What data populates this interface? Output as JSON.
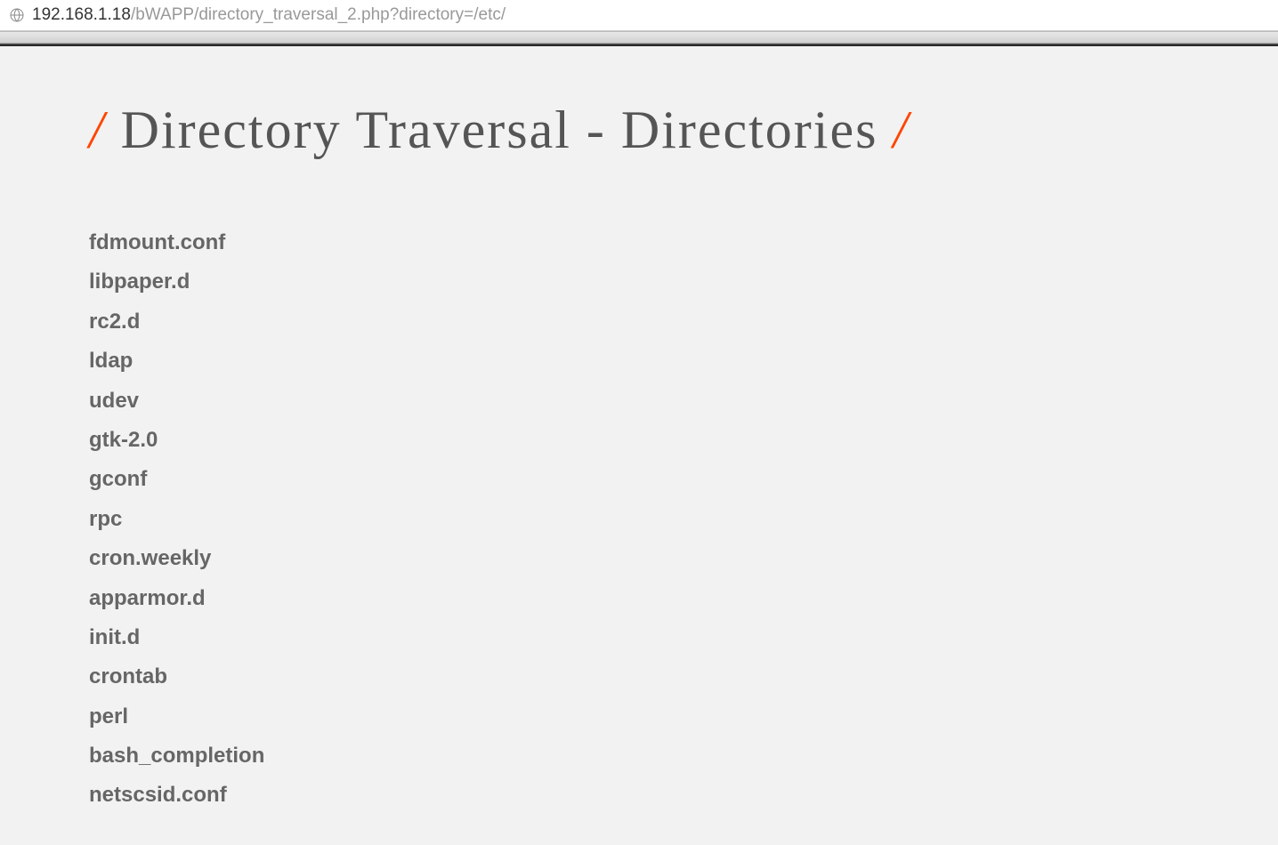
{
  "address": {
    "host": "192.168.1.18",
    "path": "/bWAPP/directory_traversal_2.php?directory=/etc/"
  },
  "title": {
    "slash_left": "/",
    "text": " Directory Traversal - Directories ",
    "slash_right": "/"
  },
  "files": [
    "fdmount.conf",
    "libpaper.d",
    "rc2.d",
    "ldap",
    "udev",
    "gtk-2.0",
    "gconf",
    "rpc",
    "cron.weekly",
    "apparmor.d",
    "init.d",
    "crontab",
    "perl",
    "bash_completion",
    "netscsid.conf"
  ]
}
